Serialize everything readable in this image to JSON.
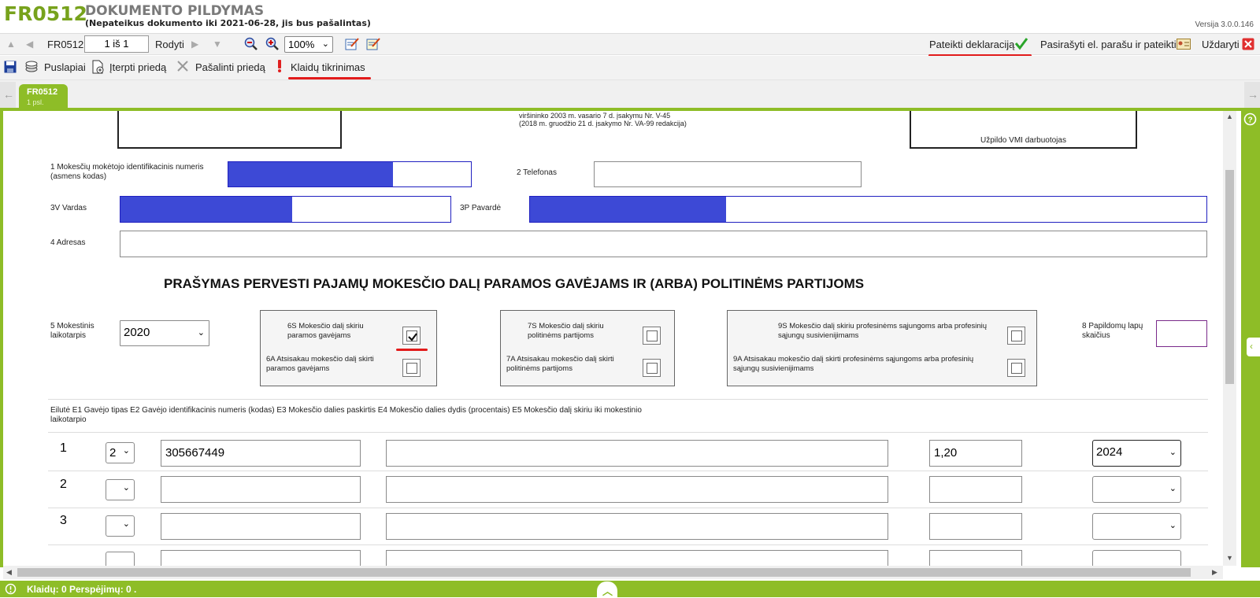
{
  "header": {
    "code": "FR0512",
    "title": "DOKUMENTO PILDYMAS",
    "subtitle": "(Nepateikus dokumento iki 2021-06-28, jis bus pašalintas)",
    "version": "Versija 3.0.0.146"
  },
  "toolbar": {
    "form_label": "FR0512",
    "page_value": "1 iš 1",
    "show_label": "Rodyti",
    "zoom_value": "100%",
    "submit_label": "Pateikti deklaraciją",
    "sign_label": "Pasirašyti el. parašu ir pateikti",
    "close_label": "Uždaryti"
  },
  "toolbar2": {
    "pages_label": "Puslapiai",
    "insert_label": "Įterpti priedą",
    "remove_label": "Pašalinti priedą",
    "check_label": "Klaidų tikrinimas"
  },
  "tab": {
    "name": "FR0512",
    "pages": "1 psl."
  },
  "form": {
    "header_note_line1": "viršininko 2003 m. vasario 7 d. įsakymu Nr. V-45",
    "header_note_line2": "(2018 m. gruodžio 21 d. įsakymo Nr. VA-99 redakcija)",
    "vmi_label": "Užpildo VMI darbuotojas",
    "f1_label": "1 Mokesčių mokėtojo identifikacinis numeris (asmens kodas)",
    "f1_fill": 0.68,
    "f2_label": "2 Telefonas",
    "f3v_label": "3V Vardas",
    "f3v_fill": 0.52,
    "f3p_label": "3P Pavardė",
    "f3p_fill": 0.29,
    "f4_label": "4 Adresas",
    "main_title": "PRAŠYMAS PERVESTI PAJAMŲ MOKESČIO DALĮ PARAMOS GAVĖJAMS IR (ARBA) POLITINĖMS PARTIJOMS",
    "f5_label": "5 Mokestinis laikotarpis",
    "f5_value": "2020",
    "c6s_label": "6S Mokesčio dalį skiriu paramos gavėjams",
    "c6s_checked": true,
    "c6a_label": "6A Atsisakau mokesčio dalį skirti paramos gavėjams",
    "c7s_label": "7S Mokesčio dalį skiriu politinėms partijoms",
    "c7a_label": "7A Atsisakau mokesčio dalį skirti politinėms partijoms",
    "c9s_label": "9S Mokesčio dalį skiriu profesinėms sąjungoms arba profesinių sąjungų susivienijimams",
    "c9a_label": "9A Atsisakau mokesčio dalį skirti profesinėms sąjungoms arba profesinių sąjungų susivienijimams",
    "f8_label": "8 Papildomų lapų skaičius",
    "table_header": "Eilutė E1 Gavėjo tipas E2 Gavėjo identifikacinis numeris (kodas) E3 Mokesčio dalies paskirtis E4 Mokesčio dalies dydis (procentais) E5 Mokesčio dalį skiriu iki mokestinio laikotarpio",
    "rows": [
      {
        "num": "1",
        "type": "2",
        "code": "305667449",
        "purpose": "",
        "percent": "1,20",
        "year": "2024"
      },
      {
        "num": "2",
        "type": "",
        "code": "",
        "purpose": "",
        "percent": "",
        "year": ""
      },
      {
        "num": "3",
        "type": "",
        "code": "",
        "purpose": "",
        "percent": "",
        "year": ""
      }
    ]
  },
  "status": {
    "text": "Klaidų: 0 Perspėjimų: 0 ."
  },
  "colors": {
    "brand_green": "#8ebd27",
    "field_blue": "#3d49d6",
    "annotation_red": "#e21b1b"
  }
}
